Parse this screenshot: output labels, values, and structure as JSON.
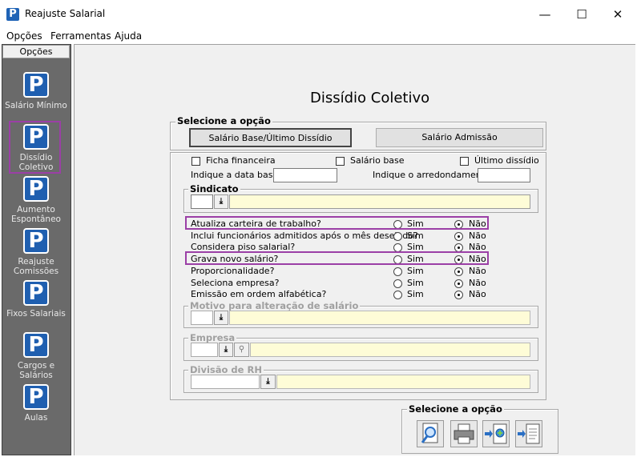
{
  "window": {
    "title": "Reajuste Salarial",
    "controls": {
      "minimize": "—",
      "maximize": "☐",
      "close": "✕"
    }
  },
  "menu": [
    "Opções",
    "Ferramentas",
    "Ajuda"
  ],
  "sidebar": {
    "header": "Opções",
    "items": [
      {
        "label": "Salário Mínimo",
        "icon": "P"
      },
      {
        "label": "Dissídio Coletivo",
        "icon": "P"
      },
      {
        "label": "Aumento Espontâneo",
        "icon": "P"
      },
      {
        "label": "Reajuste Comissões",
        "icon": "P"
      },
      {
        "label": "Fixos Salariais",
        "icon": "P"
      },
      {
        "label": "Cargos e Salários",
        "icon": "P"
      },
      {
        "label": "Aulas",
        "icon": "P"
      }
    ]
  },
  "main": {
    "title": "Dissídio Coletivo",
    "option_group": {
      "label": "Selecione a opção",
      "buttons": [
        "Salário Base/Último Dissídio",
        "Salário Admissão"
      ]
    },
    "checkboxes": {
      "ficha": "Ficha financeira",
      "salario_base": "Salário base",
      "ultimo": "Último dissídio"
    },
    "data_base_label": "Indique a data base:",
    "arredondamento_label": "Indique o arredondamento:",
    "sindicato_label": "Sindicato",
    "radio_labels": {
      "sim": "Sim",
      "nao": "Não"
    },
    "questions": [
      {
        "text": "Atualiza carteira de trabalho?",
        "selected": "nao"
      },
      {
        "text": "Inclui funcionários admitidos após o mês desejado?",
        "selected": "nao"
      },
      {
        "text": "Considera piso salarial?",
        "selected": "nao"
      },
      {
        "text": "Grava novo salário?",
        "selected": "nao"
      },
      {
        "text": "Proporcionalidade?",
        "selected": "nao"
      },
      {
        "text": "Seleciona empresa?",
        "selected": "nao"
      },
      {
        "text": "Emissão em ordem alfabética?",
        "selected": "nao"
      }
    ],
    "motivo_label": "Motivo para alteração de salário",
    "empresa_label": "Empresa",
    "divisao_label": "Divisão de RH",
    "action_group_label": "Selecione a opção",
    "actions": [
      "preview-icon",
      "printer-icon",
      "export-icon",
      "document-icon"
    ]
  },
  "colors": {
    "highlight": "#9b3fa6",
    "brand_blue": "#1f5fb0",
    "field_yellow": "#fefcd7",
    "sidebar_bg": "#6a6a6a"
  }
}
